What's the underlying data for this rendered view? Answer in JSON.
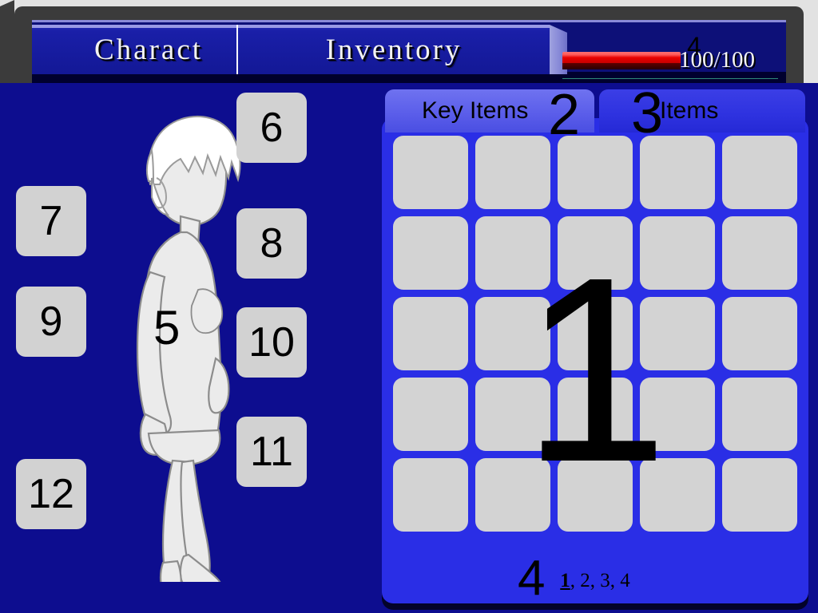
{
  "window": {
    "menu_tabs": [
      {
        "id": "character",
        "label": "Charact",
        "selected": false
      },
      {
        "id": "inventory",
        "label": "Inventory",
        "selected": true
      }
    ]
  },
  "status": {
    "hp_text": "100/100",
    "hp_percent": 100,
    "hp_color": "#e80000",
    "callout": "4"
  },
  "character_pane": {
    "body_slot_label": "5",
    "equipment_slots": [
      {
        "id": "slot-6",
        "label": "6"
      },
      {
        "id": "slot-7",
        "label": "7"
      },
      {
        "id": "slot-8",
        "label": "8"
      },
      {
        "id": "slot-9",
        "label": "9"
      },
      {
        "id": "slot-10",
        "label": "10"
      },
      {
        "id": "slot-11",
        "label": "11"
      },
      {
        "id": "slot-12",
        "label": "12"
      }
    ]
  },
  "item_panel": {
    "tabs": [
      {
        "id": "key-items",
        "label": "Key Items",
        "callout": "2",
        "selected": true
      },
      {
        "id": "items",
        "label": "Items",
        "callout": "3",
        "selected": false
      }
    ],
    "grid": {
      "rows": 5,
      "cols": 5,
      "slot_count": 25,
      "callout": "1",
      "slots": [
        "",
        "",
        "",
        "",
        "",
        "",
        "",
        "",
        "",
        "",
        "",
        "",
        "",
        "",
        "",
        "",
        "",
        "",
        "",
        "",
        "",
        "",
        "",
        "",
        ""
      ]
    },
    "pagination": {
      "callout": "4",
      "current": "1",
      "pages": [
        "1",
        "2",
        "3",
        "4"
      ],
      "separator": ", "
    }
  },
  "colors": {
    "background_navy": "#0d0d8f",
    "panel_blue": "#2a2ee6",
    "tab_selected_blue": "#5b5eea",
    "slot_gray": "#d3d3d3",
    "frame_gray": "#e2e2e2",
    "bezel_dark": "#3b3b3b",
    "hp_red": "#e80000"
  }
}
